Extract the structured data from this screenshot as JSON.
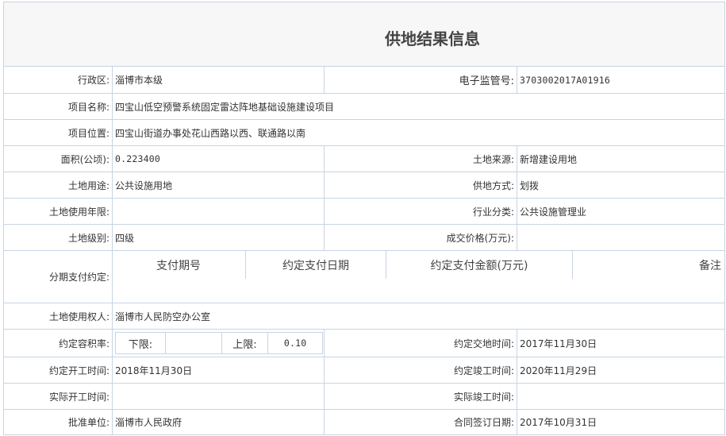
{
  "title": "供地结果信息",
  "rows": {
    "r1": {
      "l1": "行政区:",
      "v1": "淄博市本级",
      "l2": "电子监管号:",
      "v2": "3703002017A01916"
    },
    "r2": {
      "l1": "项目名称:",
      "v1": "四宝山低空预警系统固定雷达阵地基础设施建设项目"
    },
    "r3": {
      "l1": "项目位置:",
      "v1": "四宝山街道办事处花山西路以西、联通路以南"
    },
    "r4": {
      "l1": "面积(公顷):",
      "v1": "0.223400",
      "l2": "土地来源:",
      "v2": "新增建设用地"
    },
    "r5": {
      "l1": "土地用途:",
      "v1": "公共设施用地",
      "l2": "供地方式:",
      "v2": "划拨"
    },
    "r6": {
      "l1": "土地使用年限:",
      "v1": "",
      "l2": "行业分类:",
      "v2": "公共设施管理业"
    },
    "r7": {
      "l1": "土地级别:",
      "v1": "四级",
      "l2": "成交价格(万元):",
      "v2": ""
    },
    "r8": {
      "l1": "分期支付约定:",
      "headers": [
        "支付期号",
        "约定支付日期",
        "约定支付金额(万元)",
        "备注"
      ]
    },
    "r9": {
      "l1": "土地使用权人:",
      "v1": "淄博市人民防空办公室"
    },
    "r10": {
      "l1": "约定容积率:",
      "lower_label": "下限:",
      "lower_value": "",
      "upper_label": "上限:",
      "upper_value": "0.10",
      "l2": "约定交地时间:",
      "v2": "2017年11月30日"
    },
    "r11": {
      "l1": "约定开工时间:",
      "v1": "2018年11月30日",
      "l2": "约定竣工时间:",
      "v2": "2020年11月29日"
    },
    "r12": {
      "l1": "实际开工时间:",
      "v1": "",
      "l2": "实际竣工时间:",
      "v2": ""
    },
    "r13": {
      "l1": "批准单位:",
      "v1": "淄博市人民政府",
      "l2": "合同签订日期:",
      "v2": "2017年10月31日"
    }
  }
}
